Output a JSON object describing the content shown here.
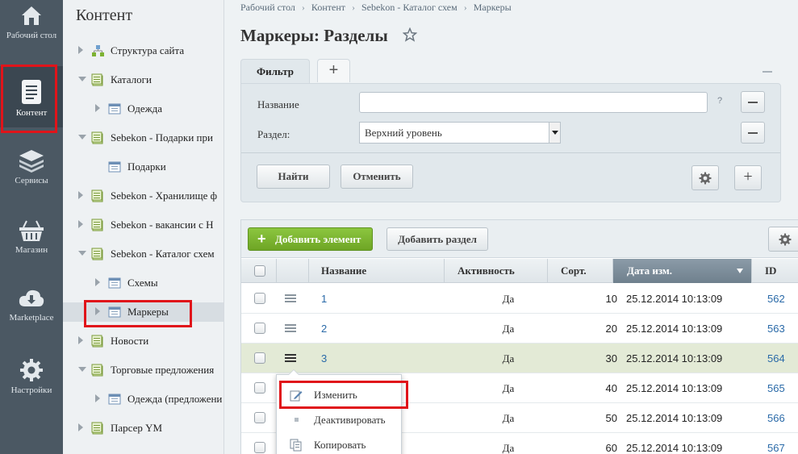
{
  "leftbar": {
    "items": [
      {
        "label": "Рабочий стол",
        "icon": "home-icon"
      },
      {
        "label": "Контент",
        "icon": "document-icon",
        "active": true
      },
      {
        "label": "Сервисы",
        "icon": "layers-icon"
      },
      {
        "label": "Магазин",
        "icon": "basket-icon"
      },
      {
        "label": "Marketplace",
        "icon": "cloud-download-icon"
      },
      {
        "label": "Настройки",
        "icon": "gear-icon"
      }
    ]
  },
  "tree": {
    "title": "Контент",
    "items": [
      {
        "label": "Структура сайта",
        "icon": "site-structure-icon",
        "expander": "right",
        "level": 0
      },
      {
        "label": "Каталоги",
        "icon": "catalog-icon",
        "expander": "down",
        "level": 0
      },
      {
        "label": "Одежда",
        "icon": "list-icon",
        "expander": "right",
        "level": 1
      },
      {
        "label": "Sebekon - Подарки при",
        "icon": "catalog-icon",
        "expander": "down",
        "level": 0
      },
      {
        "label": "Подарки",
        "icon": "list-icon",
        "expander": "dot",
        "level": 1
      },
      {
        "label": "Sebekon - Хранилище ф",
        "icon": "catalog-icon",
        "expander": "right",
        "level": 0
      },
      {
        "label": "Sebekon - вакансии с H",
        "icon": "catalog-icon",
        "expander": "right",
        "level": 0
      },
      {
        "label": "Sebekon - Каталог схем",
        "icon": "catalog-icon",
        "expander": "down",
        "level": 0
      },
      {
        "label": "Схемы",
        "icon": "list-icon",
        "expander": "right",
        "level": 1
      },
      {
        "label": "Маркеры",
        "icon": "list-icon",
        "expander": "right",
        "level": 1,
        "selected": true
      },
      {
        "label": "Новости",
        "icon": "catalog-icon",
        "expander": "right",
        "level": 0
      },
      {
        "label": "Торговые предложения",
        "icon": "catalog-icon",
        "expander": "down",
        "level": 0
      },
      {
        "label": "Одежда (предложени",
        "icon": "list-icon",
        "expander": "right",
        "level": 1
      },
      {
        "label": "Парсер YM",
        "icon": "catalog-icon",
        "expander": "right",
        "level": 0
      }
    ]
  },
  "breadcrumb": [
    "Рабочий стол",
    "Контент",
    "Sebekon - Каталог схем",
    "Маркеры"
  ],
  "page": {
    "title": "Маркеры: Разделы"
  },
  "filter": {
    "tab_label": "Фильтр",
    "add_tab": "+",
    "name_label": "Название",
    "name_value": "",
    "help": "?",
    "section_label": "Раздел:",
    "section_value": "Верхний уровень",
    "find_button": "Найти",
    "cancel_button": "Отменить",
    "plus": "+"
  },
  "grid": {
    "add_element": "Добавить элемент",
    "add_section": "Добавить раздел",
    "columns": {
      "name": "Название",
      "active": "Активность",
      "sort": "Сорт.",
      "date": "Дата изм.",
      "id": "ID"
    },
    "rows": [
      {
        "name": "1",
        "active": "Да",
        "sort": "10",
        "date": "25.12.2014 10:13:09",
        "id": "562"
      },
      {
        "name": "2",
        "active": "Да",
        "sort": "20",
        "date": "25.12.2014 10:13:09",
        "id": "563"
      },
      {
        "name": "3",
        "active": "Да",
        "sort": "30",
        "date": "25.12.2014 10:13:09",
        "id": "564"
      },
      {
        "name": "",
        "active": "Да",
        "sort": "40",
        "date": "25.12.2014 10:13:09",
        "id": "565"
      },
      {
        "name": "",
        "active": "Да",
        "sort": "50",
        "date": "25.12.2014 10:13:09",
        "id": "566"
      },
      {
        "name": "",
        "active": "Да",
        "sort": "60",
        "date": "25.12.2014 10:13:09",
        "id": "567"
      }
    ]
  },
  "context_menu": {
    "items": [
      {
        "label": "Изменить",
        "icon": "edit-icon"
      },
      {
        "label": "Деактивировать",
        "icon": "dot-icon"
      },
      {
        "label": "Копировать",
        "icon": "copy-icon"
      }
    ]
  },
  "colors": {
    "highlight": "#e0141a",
    "accent_green": "#7db232",
    "link": "#2a6aa8"
  }
}
